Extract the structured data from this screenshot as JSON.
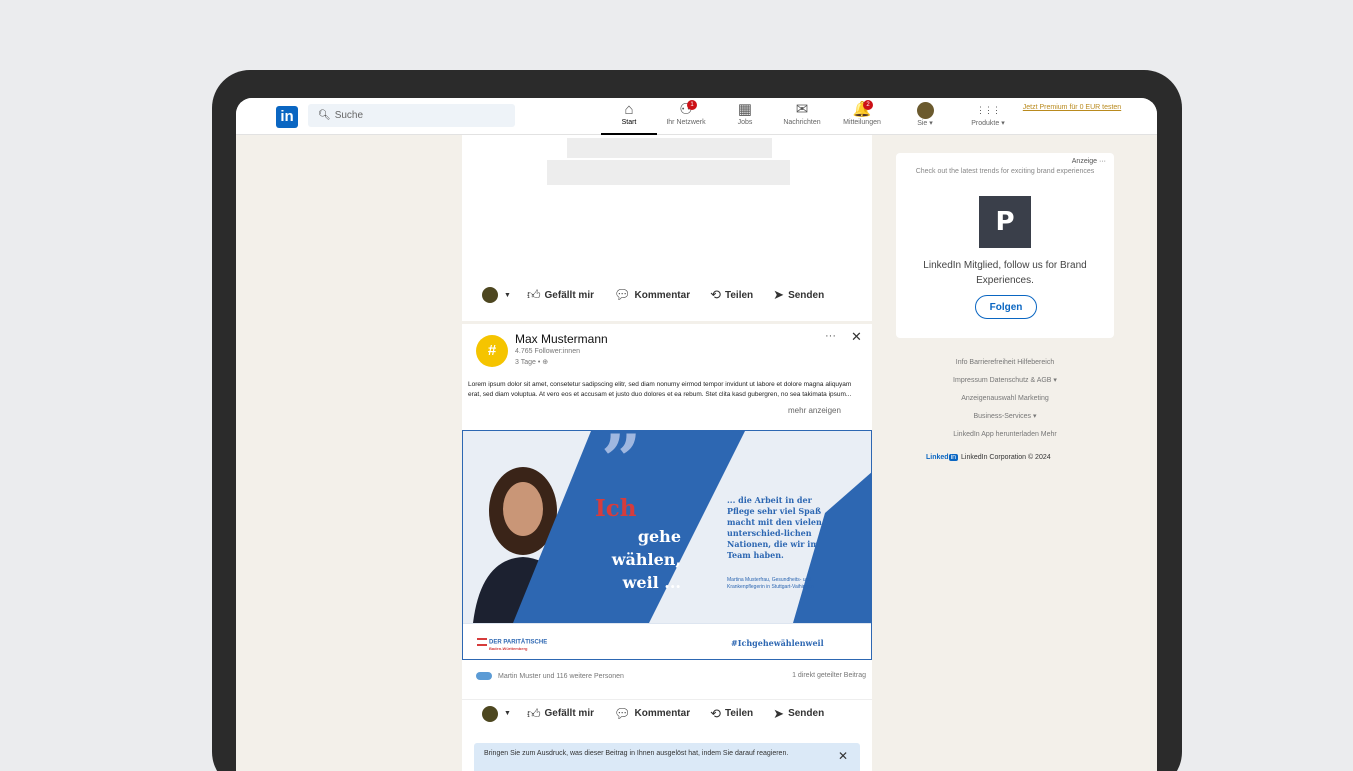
{
  "header": {
    "logo": "in",
    "search_placeholder": "Suche",
    "nav": [
      {
        "label": "Start",
        "icon": "home-icon",
        "glyph": "⌂",
        "active": true
      },
      {
        "label": "Ihr Netzwerk",
        "icon": "network-icon",
        "glyph": "⚇",
        "badge": "1"
      },
      {
        "label": "Jobs",
        "icon": "briefcase-icon",
        "glyph": "▦"
      },
      {
        "label": "Nachrichten",
        "icon": "message-icon",
        "glyph": "✉"
      },
      {
        "label": "Mitteilungen",
        "icon": "bell-icon",
        "glyph": "🔔",
        "badge": "2"
      },
      {
        "label": "Sie ▾",
        "icon": "avatar"
      },
      {
        "label": "Produkte ▾",
        "icon": "grid-icon",
        "glyph": "⋮⋮⋮"
      }
    ],
    "premium": "Jetzt Premium für 0 EUR testen"
  },
  "actions": {
    "like": "Gefällt mir",
    "comment": "Kommentar",
    "share": "Teilen",
    "send": "Senden"
  },
  "post": {
    "author": "Max Mustermann",
    "followers": "4.765 Follower:innen",
    "time": "3 Tage • ⊕",
    "text": "Lorem ipsum dolor sit amet, consetetur sadipscing elitr, sed diam nonumy eirmod tempor invidunt ut labore et dolore magna aliquyam erat, sed diam voluptua. At vero eos et accusam et justo duo dolores et ea rebum. Stet clita kasd gubergren, no sea takimata ipsum...",
    "more": "mehr anzeigen",
    "image": {
      "headline_red": "Ich",
      "headline_lines": [
        "gehe",
        "wählen,",
        "weil ..."
      ],
      "quote": "... die Arbeit in der Pflege sehr viel Spaß macht mit den vielen unterschied-lichen Nationen, die wir im Team haben.",
      "quote_author": "Martina Musterfrau, Gesundheits- und Krankenpflegerin in Stuttgart-Vaihingen",
      "org": "DER PARITÄTISCHE",
      "org_sub": "Baden-Württemberg",
      "hashtag": "#Ichgehewählenweil"
    },
    "reactions": "Martin Muster und 116 weitere Personen",
    "shares": "1 direkt geteilter Beitrag",
    "notice": "Bringen Sie zum Ausdruck, was dieser Beitrag in Ihnen ausgelöst hat, indem Sie darauf reagieren."
  },
  "sidebar": {
    "ad_label": "Anzeige ···",
    "tagline": "Check out the latest trends for exciting brand experiences",
    "logo_letter": "P",
    "member_text": "LinkedIn Mitglied, follow us for Brand Experiences.",
    "follow": "Folgen",
    "links": [
      "Info   Barrierefreiheit   Hilfebereich",
      "Impressum   Datenschutz & AGB ▾",
      "Anzeigenauswahl   Marketing",
      "Business-Services ▾",
      "LinkedIn App herunterladen   Mehr"
    ],
    "copyright_brand": "Linked",
    "copyright_box": "in",
    "copyright": "LinkedIn Corporation © 2024"
  },
  "colors": {
    "brand": "#0a66c2",
    "accent_red": "#d63c3c",
    "ad_blue": "#2d67b2",
    "premium": "#b98a1e"
  }
}
